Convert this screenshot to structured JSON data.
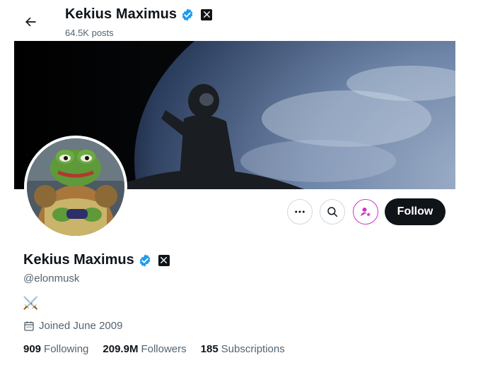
{
  "header": {
    "name": "Kekius Maximus",
    "posts": "64.5K posts",
    "back_icon": "arrow-left-icon"
  },
  "profile": {
    "name": "Kekius Maximus",
    "handle": "@elonmusk",
    "bio": "⚔️",
    "joined": "Joined June 2009",
    "verified_color": "#1d9bf0"
  },
  "actions": {
    "more_icon": "more-horizontal-icon",
    "search_icon": "search-icon",
    "subscribe_icon": "subscribe-icon",
    "subscribe_color": "#c936cc",
    "follow_label": "Follow"
  },
  "stats": [
    {
      "num": "909",
      "label": "Following"
    },
    {
      "num": "209.9M",
      "label": "Followers"
    },
    {
      "num": "185",
      "label": "Subscriptions"
    }
  ]
}
